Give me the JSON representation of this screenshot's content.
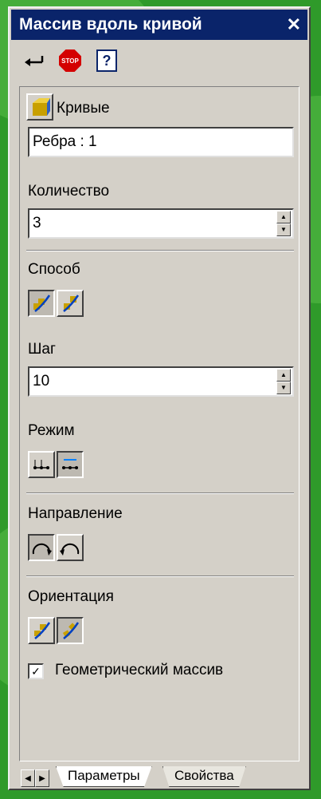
{
  "window": {
    "title": "Массив вдоль кривой",
    "close_glyph": "✕"
  },
  "toolbar": {
    "stop_label": "STOP",
    "help_label": "?"
  },
  "sections": {
    "curves_label": "Кривые",
    "curves_value": "Ребра : 1",
    "count_label": "Количество",
    "count_value": "3",
    "method_label": "Способ",
    "step_label": "Шаг",
    "step_value": "10",
    "mode_label": "Режим",
    "direction_label": "Направление",
    "orientation_label": "Ориентация",
    "geometric_label": "Геометрический массив",
    "geometric_checked": true
  },
  "tabs": [
    {
      "label": "Параметры",
      "active": true
    },
    {
      "label": "Свойства",
      "active": false
    }
  ],
  "icons": [
    "enter-icon",
    "stop-icon",
    "help-icon",
    "curves-icon",
    "method-icon-1",
    "method-icon-2",
    "mode-icon-1",
    "mode-icon-2",
    "direction-cw-icon",
    "direction-ccw-icon",
    "orientation-icon-1",
    "orientation-icon-2"
  ],
  "colors": {
    "titlebar": "#0a246a",
    "background": "#2f9a2a",
    "panel": "#d4d0c8"
  }
}
